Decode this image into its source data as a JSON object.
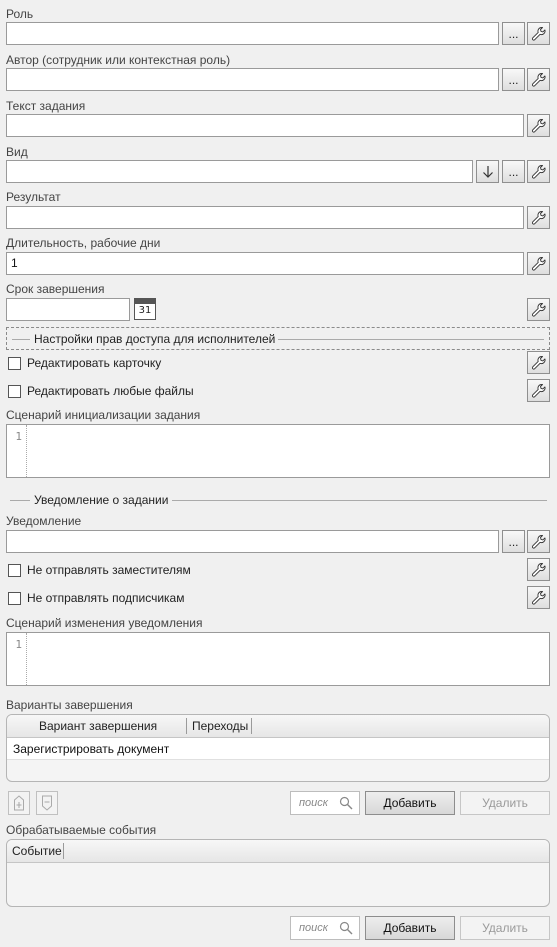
{
  "fields": {
    "role": {
      "label": "Роль",
      "value": ""
    },
    "author": {
      "label": "Автор (сотрудник или контекстная роль)",
      "value": ""
    },
    "task_text": {
      "label": "Текст задания",
      "value": ""
    },
    "kind": {
      "label": "Вид",
      "value": ""
    },
    "result": {
      "label": "Результат",
      "value": ""
    },
    "duration": {
      "label": "Длительность, рабочие дни",
      "value": "1"
    },
    "deadline": {
      "label": "Срок завершения",
      "value": "",
      "calendar_day": "31"
    }
  },
  "ellipsis_label": "...",
  "access_group": {
    "title": "Настройки прав доступа для исполнителей",
    "edit_card": "Редактировать карточку",
    "edit_files": "Редактировать любые файлы"
  },
  "task_init_script": {
    "label": "Сценарий инициализации задания",
    "line_number": "1"
  },
  "notification_section": {
    "title": "Уведомление о задании",
    "notification": {
      "label": "Уведомление",
      "value": ""
    },
    "no_deputies": "Не отправлять заместителям",
    "no_subscribers": "Не отправлять подписчикам",
    "change_script": {
      "label": "Сценарий изменения уведомления",
      "line_number": "1"
    }
  },
  "completion_options": {
    "label": "Варианты завершения",
    "columns": [
      "Вариант завершения",
      "Переходы"
    ],
    "rows": [
      {
        "option": "Зарегистрировать документ",
        "transitions": ""
      }
    ],
    "search_placeholder": "поиск",
    "add": "Добавить",
    "delete": "Удалить"
  },
  "processed_events": {
    "label": "Обрабатываемые события",
    "columns": [
      "Событие"
    ],
    "search_placeholder": "поиск",
    "add": "Добавить",
    "delete": "Удалить"
  },
  "icons": {
    "settings": "wrench-icon",
    "arrow_down": "arrow-down-icon",
    "calendar": "calendar-icon",
    "search": "magnifier-icon",
    "move_up": "move-up-icon",
    "move_down": "move-down-icon"
  },
  "colors": {
    "background": "#f0f0f0",
    "input_border": "#9a9a9a",
    "disabled_text": "#9a9a9a"
  }
}
